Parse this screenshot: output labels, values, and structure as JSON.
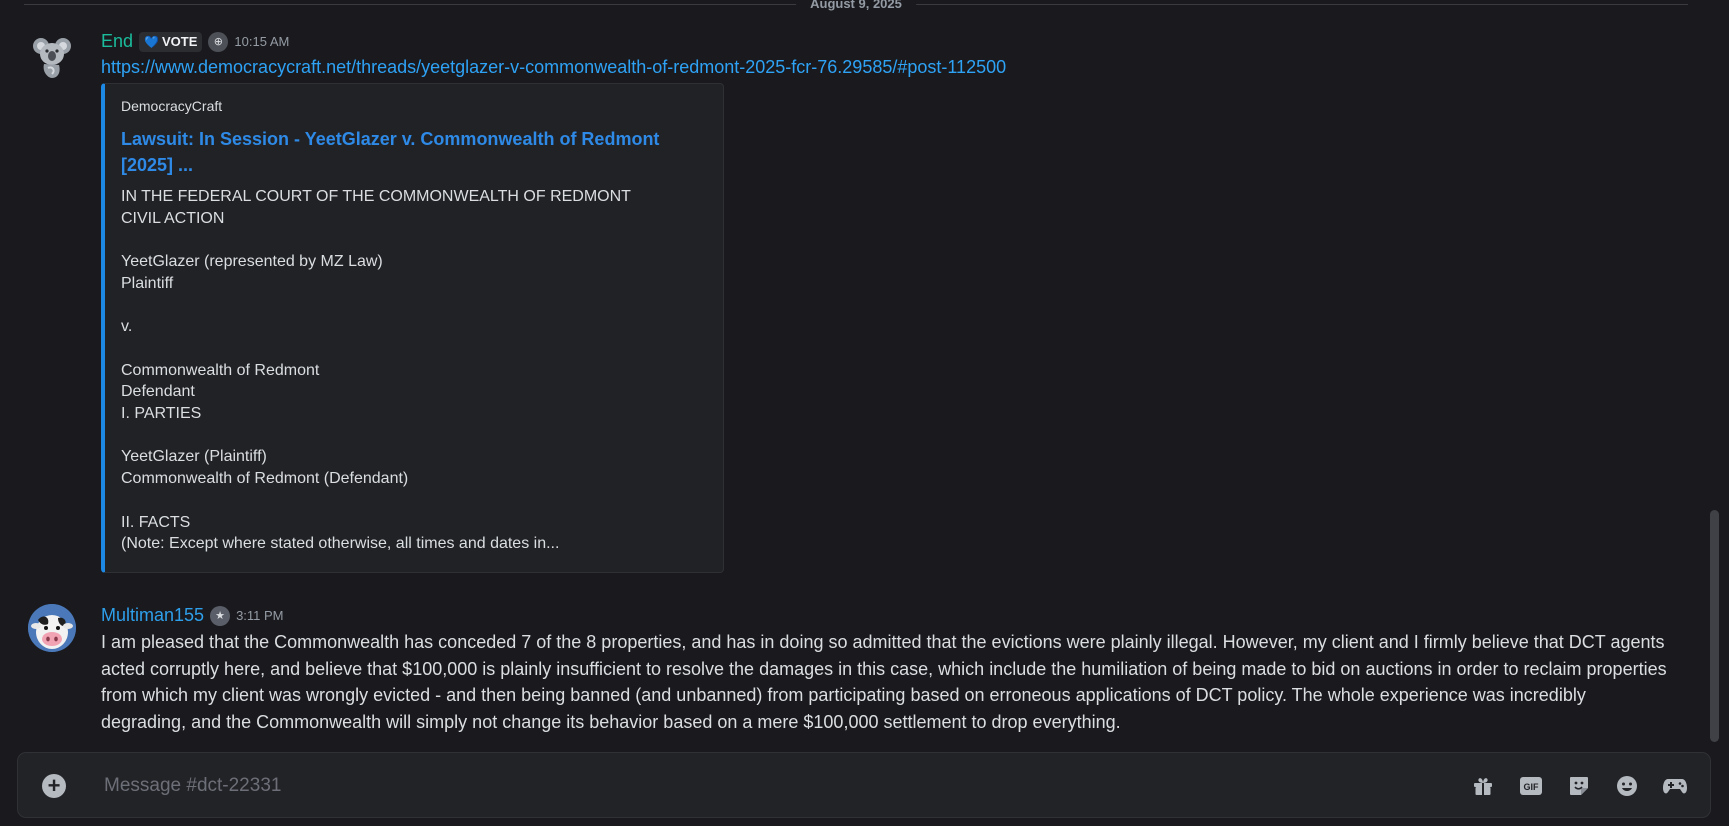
{
  "date_divider": "August 9, 2025",
  "messages": [
    {
      "username": "End",
      "username_color": "#1abc9c",
      "badge_text": "VOTE",
      "timestamp": "10:15 AM",
      "link": "https://www.democracycraft.net/threads/yeetglazer-v-commonwealth-of-redmont-2025-fcr-76.29585/#post-112500",
      "embed": {
        "provider": "DemocracyCraft",
        "title": "Lawsuit: In Session - YeetGlazer v. Commonwealth of Redmont [2025] ...",
        "description": "IN THE FEDERAL COURT OF THE COMMONWEALTH OF REDMONT\nCIVIL ACTION\n\nYeetGlazer (represented by MZ Law)\nPlaintiff\n\nv.\n\nCommonwealth of Redmont\nDefendant\nI. PARTIES\n\nYeetGlazer (Plaintiff)\nCommonwealth of Redmont (Defendant)\n\nII. FACTS\n(Note: Except where stated otherwise, all times and dates in..."
      }
    },
    {
      "username": "Multiman155",
      "username_color": "#2e9fea",
      "timestamp": "3:11 PM",
      "text": "I am pleased that the Commonwealth has conceded 7 of the 8 properties, and has in doing so admitted that the evictions were plainly illegal. However, my client and I firmly believe that DCT agents acted corruptly here, and believe that $100,000 is plainly insufficient to resolve the damages in this case, which include the humiliation of being made to bid on auctions in order to reclaim properties from which my client was wrongly evicted - and then being banned (and unbanned) from participating based on erroneous applications of DCT policy. The whole experience was incredibly degrading, and the Commonwealth will simply not change its behavior based on a mere $100,000 settlement to drop everything."
    }
  ],
  "composer": {
    "placeholder": "Message #dct-22331",
    "gif_label": "GIF",
    "icons": [
      "plus-circle-icon",
      "gift-icon",
      "gif-icon",
      "sticker-icon",
      "emoji-icon",
      "activity-icon"
    ]
  }
}
